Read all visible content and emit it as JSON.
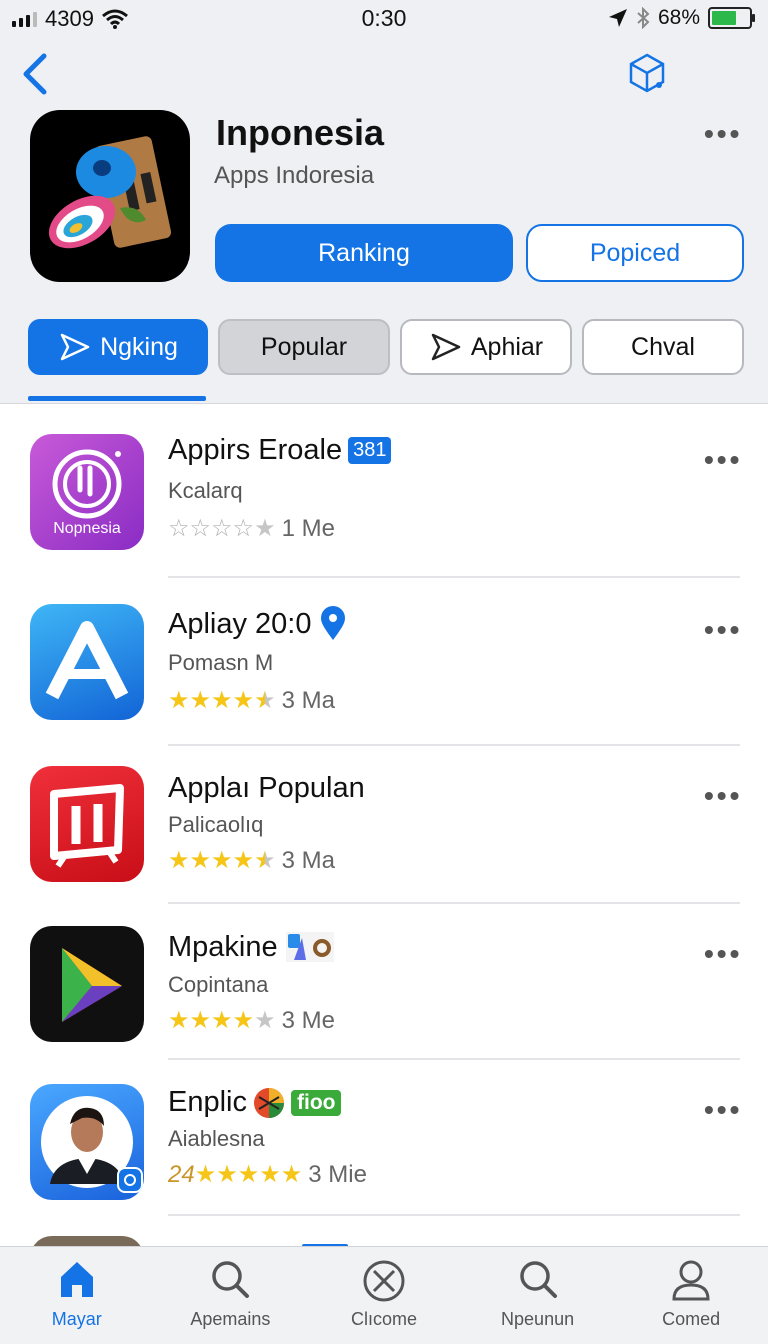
{
  "status_bar": {
    "carrier": "4309",
    "time": "0:30",
    "battery": "68%",
    "icons": [
      "signal-icon",
      "wifi-icon",
      "location-icon",
      "bluetooth-icon",
      "battery-icon"
    ]
  },
  "header": {
    "back_icon": "chevron-left-icon",
    "ar_icon": "ar-cube-icon",
    "title": "Inponesia",
    "subtitle": "Apps Indoresia",
    "more": "•••",
    "primary_button": "Ranking",
    "secondary_button": "Popiced"
  },
  "segments": [
    {
      "label": "Ngking",
      "state": "active",
      "icon": "play-icon"
    },
    {
      "label": "Popular",
      "state": "grey"
    },
    {
      "label": "Aphiar",
      "state": "outline",
      "icon": "play-icon"
    },
    {
      "label": "Chval",
      "state": "outline"
    }
  ],
  "apps": [
    {
      "name": "Appirs Eroale",
      "badge": "381",
      "developer": "Kcalarq",
      "rating": 0,
      "count": "1 Me",
      "icon_label": "Nopnesia",
      "more": "•••"
    },
    {
      "name": "Apliay 20:0",
      "badge_icon": "map-pin-icon",
      "developer": "Pomasn M",
      "rating": 4.5,
      "count": "3 Ma",
      "more": "•••"
    },
    {
      "name": "Applaı Populan",
      "developer": "Palicaolıq",
      "rating": 4.5,
      "count": "3 Ma",
      "more": "•••"
    },
    {
      "name": "Mpakine",
      "badge_icon": "app-badge-icon",
      "developer": "Copintana",
      "rating": 4,
      "count": "3 Me",
      "more": "•••"
    },
    {
      "name": "Enplic",
      "badge": "fioo",
      "badge_icon": "pinwheel-icon",
      "developer": "Aiablesna",
      "rating_prefix": "24",
      "rating": 5,
      "count": "3 Mie",
      "more": "•••"
    }
  ],
  "tabs": [
    {
      "label": "Mayar",
      "icon": "home-icon",
      "active": true
    },
    {
      "label": "Apemains",
      "icon": "search-icon",
      "active": false
    },
    {
      "label": "Clıcome",
      "icon": "cancel-circle-icon",
      "active": false
    },
    {
      "label": "Npeunun",
      "icon": "search-icon",
      "active": false
    },
    {
      "label": "Comed",
      "icon": "person-icon",
      "active": false
    }
  ],
  "colors": {
    "accent": "#1474e6",
    "star": "#f5c518",
    "header_bg": "#eef0f3"
  }
}
